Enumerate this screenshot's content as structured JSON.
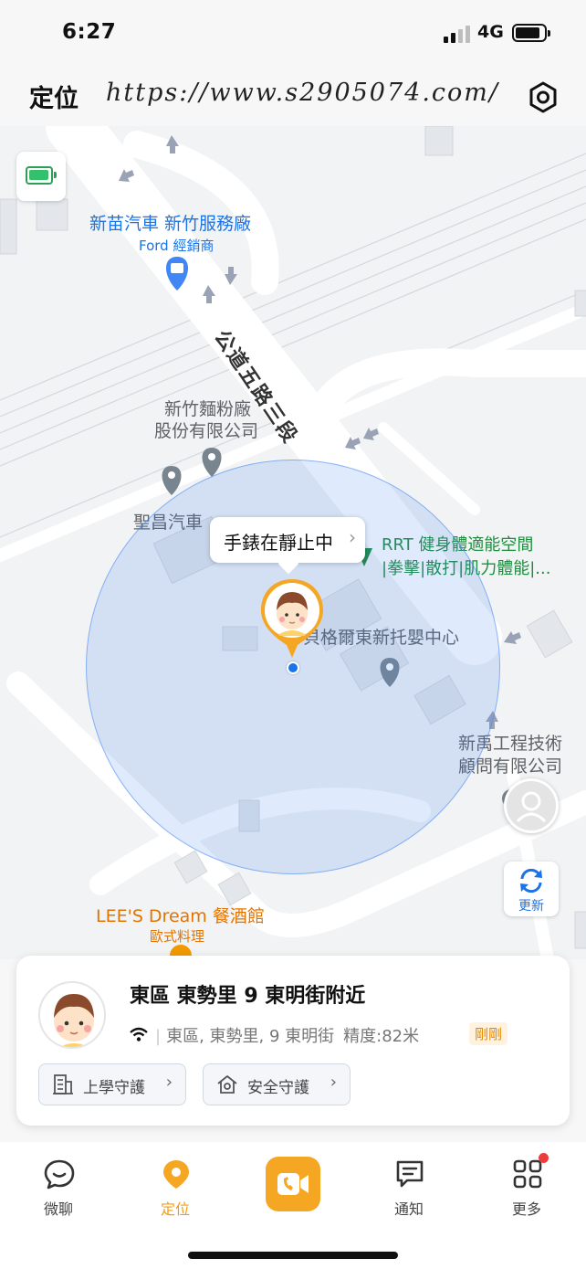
{
  "status_bar": {
    "time": "6:27",
    "network": "4G"
  },
  "header": {
    "title": "定位",
    "url_watermark": "https://www.s2905074.com/"
  },
  "map": {
    "road_name": "公道五路三段",
    "pois": {
      "ford_name": "新苗汽車 新竹服務廠",
      "ford_sub": "Ford 經銷商",
      "flour_line1": "新竹麵粉廠",
      "flour_line2": "股份有限公司",
      "shengchang": "聖昌汽車",
      "gym_line1": "RRT 健身體適能空間",
      "gym_line2": "|拳擊|散打|肌力體能|...",
      "nursery": "貝格爾東新托嬰中心",
      "engineering_line1": "新禹工程技術",
      "engineering_line2": "顧問有限公司",
      "restaurant_name": "LEE'S Dream 餐酒館",
      "restaurant_sub": "歐式料理"
    },
    "bubble_text": "手錶在靜止中",
    "refresh_label": "更新"
  },
  "location_card": {
    "title": "東區 東勢里 9 東明街附近",
    "address": "東區, 東勢里, 9 東明街",
    "accuracy": "精度:82米",
    "time_badge": "剛剛",
    "school_guard": "上學守護",
    "safety_guard": "安全守護"
  },
  "tabbar": {
    "chat": "微聊",
    "location": "定位",
    "notify": "通知",
    "more": "更多"
  },
  "colors": {
    "accent_orange": "#f5a623",
    "map_blue": "#1a73e8",
    "accuracy_fill": "#4285f4",
    "battery_green": "#35c06b",
    "notify_dot": "#ee3b3b"
  }
}
